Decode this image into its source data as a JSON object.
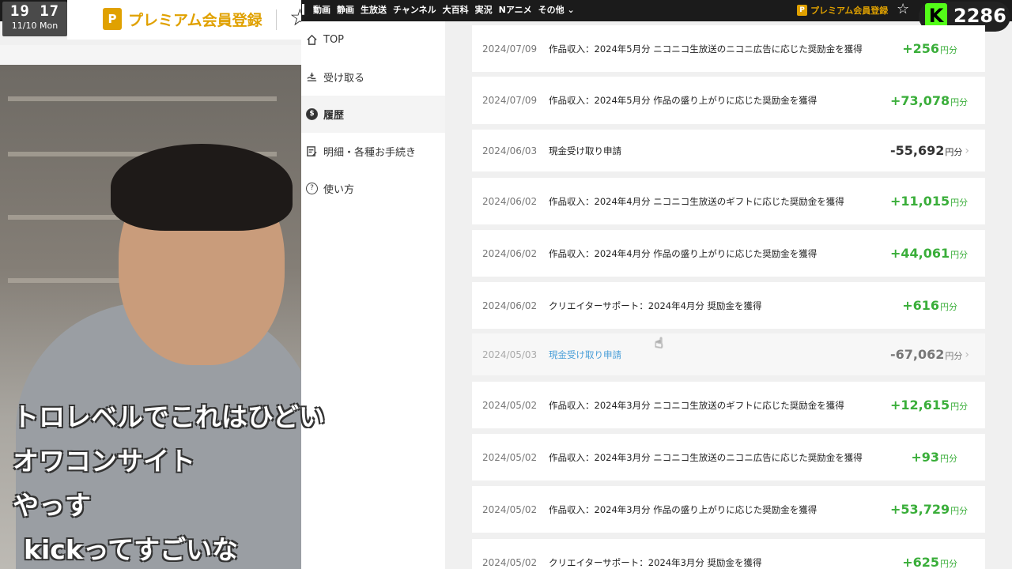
{
  "clock": {
    "time": "19 17",
    "date": "11/10 Mon"
  },
  "topnav": {
    "links": [
      "動画",
      "静画",
      "生放送",
      "チャンネル",
      "大百科",
      "実況",
      "Nアニメ",
      "その他 ⌄"
    ],
    "premium_label": "プレミアム会員登録"
  },
  "header": {
    "premium_label": "プレミアム会員登録",
    "p_badge": "P"
  },
  "kick": {
    "count": "2286",
    "logo": "K"
  },
  "sidebar": {
    "items": [
      {
        "label": "TOP",
        "icon": "home-icon"
      },
      {
        "label": "受け取る",
        "icon": "receive-icon"
      },
      {
        "label": "履歴",
        "icon": "history-coin-icon"
      },
      {
        "label": "明細・各種お手続き",
        "icon": "document-edit-icon"
      },
      {
        "label": "使い方",
        "icon": "help-circle-icon"
      }
    ]
  },
  "transactions": [
    {
      "date": "2024/07/09",
      "desc": "作品収入：2024年5月分 ニコニコ生放送のニコニ広告に応じた奨励金を獲得",
      "amount": "+256",
      "unit": "円分",
      "type": "pos"
    },
    {
      "date": "2024/07/09",
      "desc": "作品収入：2024年5月分 作品の盛り上がりに応じた奨励金を獲得",
      "amount": "+73,078",
      "unit": "円分",
      "type": "pos"
    },
    {
      "date": "2024/06/03",
      "desc": "現金受け取り申請",
      "amount": "-55,692",
      "unit": "円分",
      "type": "neg"
    },
    {
      "date": "2024/06/02",
      "desc": "作品収入：2024年4月分 ニコニコ生放送のギフトに応じた奨励金を獲得",
      "amount": "+11,015",
      "unit": "円分",
      "type": "pos"
    },
    {
      "date": "2024/06/02",
      "desc": "作品収入：2024年4月分 作品の盛り上がりに応じた奨励金を獲得",
      "amount": "+44,061",
      "unit": "円分",
      "type": "pos"
    },
    {
      "date": "2024/06/02",
      "desc": "クリエイターサポート：2024年4月分 奨励金を獲得",
      "amount": "+616",
      "unit": "円分",
      "type": "pos"
    },
    {
      "date": "2024/05/03",
      "desc": "現金受け取り申請",
      "amount": "-67,062",
      "unit": "円分",
      "type": "faded"
    },
    {
      "date": "2024/05/02",
      "desc": "作品収入：2024年3月分 ニコニコ生放送のギフトに応じた奨励金を獲得",
      "amount": "+12,615",
      "unit": "円分",
      "type": "pos"
    },
    {
      "date": "2024/05/02",
      "desc": "作品収入：2024年3月分 ニコニコ生放送のニコニ広告に応じた奨励金を獲得",
      "amount": "+93",
      "unit": "円分",
      "type": "pos"
    },
    {
      "date": "2024/05/02",
      "desc": "作品収入：2024年3月分 作品の盛り上がりに応じた奨励金を獲得",
      "amount": "+53,729",
      "unit": "円分",
      "type": "pos"
    },
    {
      "date": "2024/05/02",
      "desc": "クリエイターサポート：2024年3月分 奨励金を獲得",
      "amount": "+625",
      "unit": "円分",
      "type": "pos"
    }
  ],
  "overlay_comments": [
    "トロレベルでこれはひどい",
    "オワコンサイト",
    "やっす",
    "kickってすごいな"
  ]
}
